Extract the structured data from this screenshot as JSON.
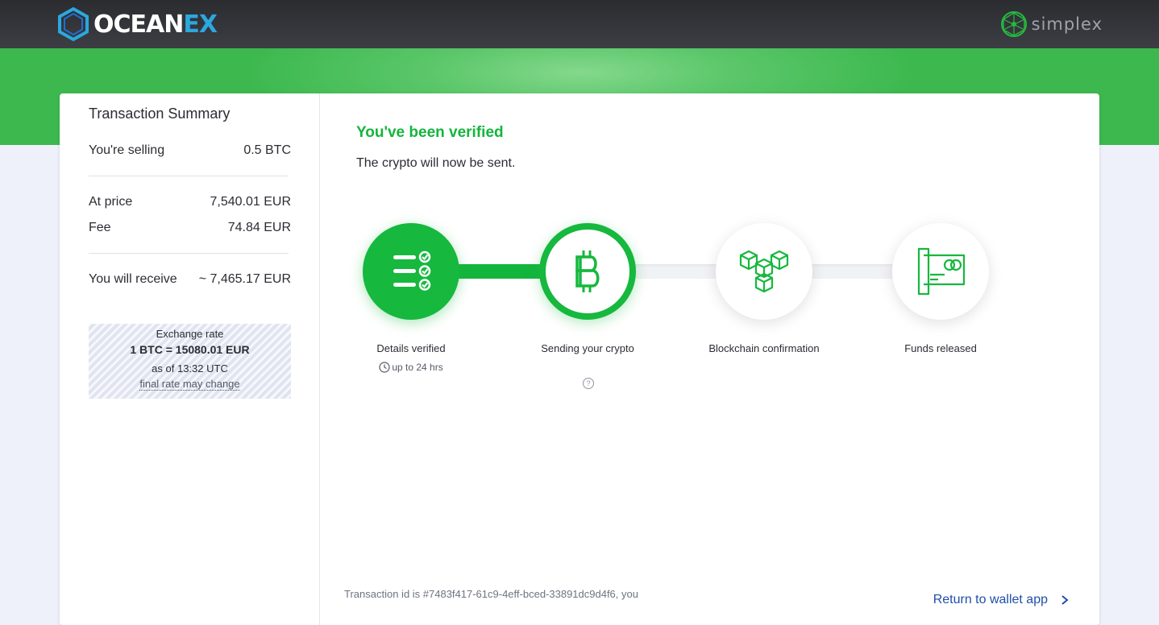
{
  "header": {
    "brand": {
      "name_prefix": "OCEAN",
      "name_suffix": "EX",
      "logo_icon": "hexagon-logo-icon"
    },
    "partner": {
      "name": "simplex",
      "logo_icon": "network-globe-icon"
    }
  },
  "summary": {
    "title": "Transaction Summary",
    "selling_label": "You're selling",
    "selling_value": "0.5 BTC",
    "price_label": "At price",
    "price_value": "7,540.01 EUR",
    "fee_label": "Fee",
    "fee_value": "74.84 EUR",
    "receive_label": "You will receive",
    "receive_value": "~ 7,465.17 EUR",
    "rate": {
      "label": "Exchange rate",
      "value": "1 BTC = 15080.01 EUR",
      "as_of": "as of 13:32 UTC",
      "note": "final rate may change"
    }
  },
  "status": {
    "title": "You've been verified",
    "subtitle": "The crypto will now be sent."
  },
  "steps": [
    {
      "label": "Details verified",
      "meta": "up to 24 hrs",
      "icon": "checklist-icon",
      "state": "done"
    },
    {
      "label": "Sending your crypto",
      "icon": "bitcoin-icon",
      "state": "active"
    },
    {
      "label": "Blockchain confirmation",
      "icon": "blocks-icon",
      "state": "pending"
    },
    {
      "label": "Funds released",
      "icon": "credit-card-icon",
      "state": "pending"
    }
  ],
  "progress": {
    "completed_fraction": 0.33
  },
  "footer": {
    "transaction_text": "Transaction id is #7483f417-61c9-4eff-bced-33891dc9d4f6, you",
    "return_label": "Return to wallet app"
  },
  "colors": {
    "brand_green": "#16b83e",
    "brand_blue": "#2aa8e0",
    "link_blue": "#1f4ea8"
  }
}
